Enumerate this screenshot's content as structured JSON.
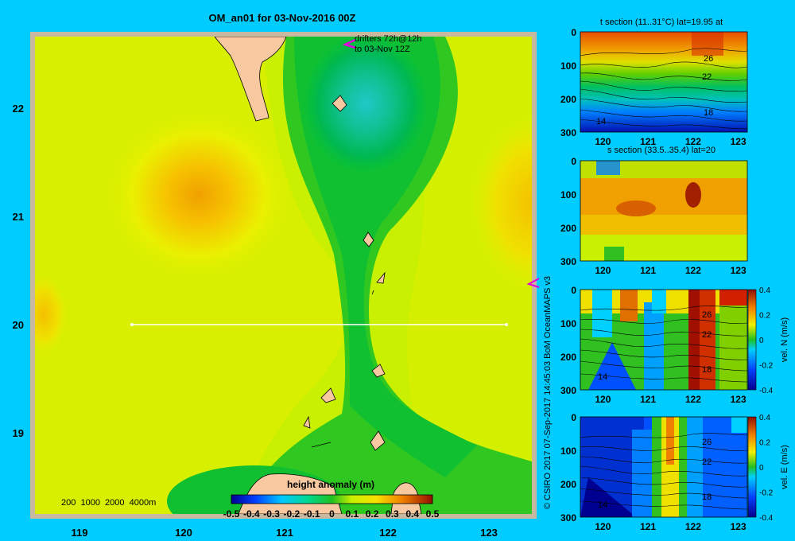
{
  "map": {
    "title": "OM_an01 for 03-Nov-2016 00Z",
    "drifter_note_line1": "drifters 72h@12h",
    "drifter_note_line2": "to 03-Nov 12Z",
    "depth_legend": "200  1000  2000  4000m",
    "colorbar_title": "height anomaly (m)",
    "colorbar_ticks": [
      "-0.5",
      "-0.4",
      "-0.3",
      "-0.2",
      "-0.1",
      "0",
      "0.1",
      "0.2",
      "0.3",
      "0.4",
      "0.5"
    ],
    "credit": "© CSIRO 2017   07-Sep-2017 14:45:03 BoM OceanMAPS v3",
    "section_line": {
      "lat": 20,
      "lon_start": 119.5,
      "lon_end": 123.2
    }
  },
  "panels": {
    "p1": {
      "title": "t section (11..31°C) lat=19.95 at"
    },
    "p2": {
      "title": "s section (33.5..35.4) lat=20"
    },
    "p3": {
      "cbar_label": "vel. N (m/s)"
    },
    "p4": {
      "cbar_label": "vel. E (m/s)"
    }
  },
  "chart_data": [
    {
      "type": "heatmap",
      "title": "OM_an01 for 03-Nov-2016 00Z",
      "variable": "height anomaly (m)",
      "x_ticks": [
        "119",
        "120",
        "121",
        "122",
        "123"
      ],
      "y_ticks": [
        "19",
        "20",
        "21",
        "22"
      ],
      "xlim": [
        118.5,
        123.5
      ],
      "ylim": [
        18.2,
        22.7
      ],
      "colorbar_range": [
        -0.5,
        0.5
      ]
    },
    {
      "type": "heatmap",
      "title": "t section (11..31°C) lat=19.95 at",
      "x_ticks": [
        "120",
        "121",
        "122",
        "123"
      ],
      "y_ticks": [
        "0",
        "100",
        "200",
        "300"
      ],
      "xlim": [
        119.5,
        123.2
      ],
      "ylim": [
        300,
        0
      ],
      "contour_labels": [
        "26",
        "22",
        "18",
        "14"
      ]
    },
    {
      "type": "heatmap",
      "title": "s section (33.5..35.4) lat=20",
      "x_ticks": [
        "120",
        "121",
        "122",
        "123"
      ],
      "y_ticks": [
        "0",
        "100",
        "200",
        "300"
      ],
      "xlim": [
        119.5,
        123.2
      ],
      "ylim": [
        300,
        0
      ]
    },
    {
      "type": "heatmap",
      "variable": "vel. N (m/s)",
      "x_ticks": [
        "120",
        "121",
        "122",
        "123"
      ],
      "y_ticks": [
        "0",
        "100",
        "200",
        "300"
      ],
      "xlim": [
        119.5,
        123.2
      ],
      "ylim": [
        300,
        0
      ],
      "contour_labels": [
        "26",
        "22",
        "18",
        "14"
      ],
      "colorbar_ticks": [
        "0.4",
        "0.2",
        "0",
        "-0.2",
        "-0.4"
      ],
      "colorbar_range": [
        -0.4,
        0.4
      ]
    },
    {
      "type": "heatmap",
      "variable": "vel. E (m/s)",
      "x_ticks": [
        "120",
        "121",
        "122",
        "123"
      ],
      "y_ticks": [
        "0",
        "100",
        "200",
        "300"
      ],
      "xlim": [
        119.5,
        123.2
      ],
      "ylim": [
        300,
        0
      ],
      "contour_labels": [
        "26",
        "22",
        "18",
        "14"
      ],
      "colorbar_ticks": [
        "0.4",
        "0.2",
        "0",
        "-0.2",
        "-0.4"
      ],
      "colorbar_range": [
        -0.4,
        0.4
      ]
    }
  ]
}
